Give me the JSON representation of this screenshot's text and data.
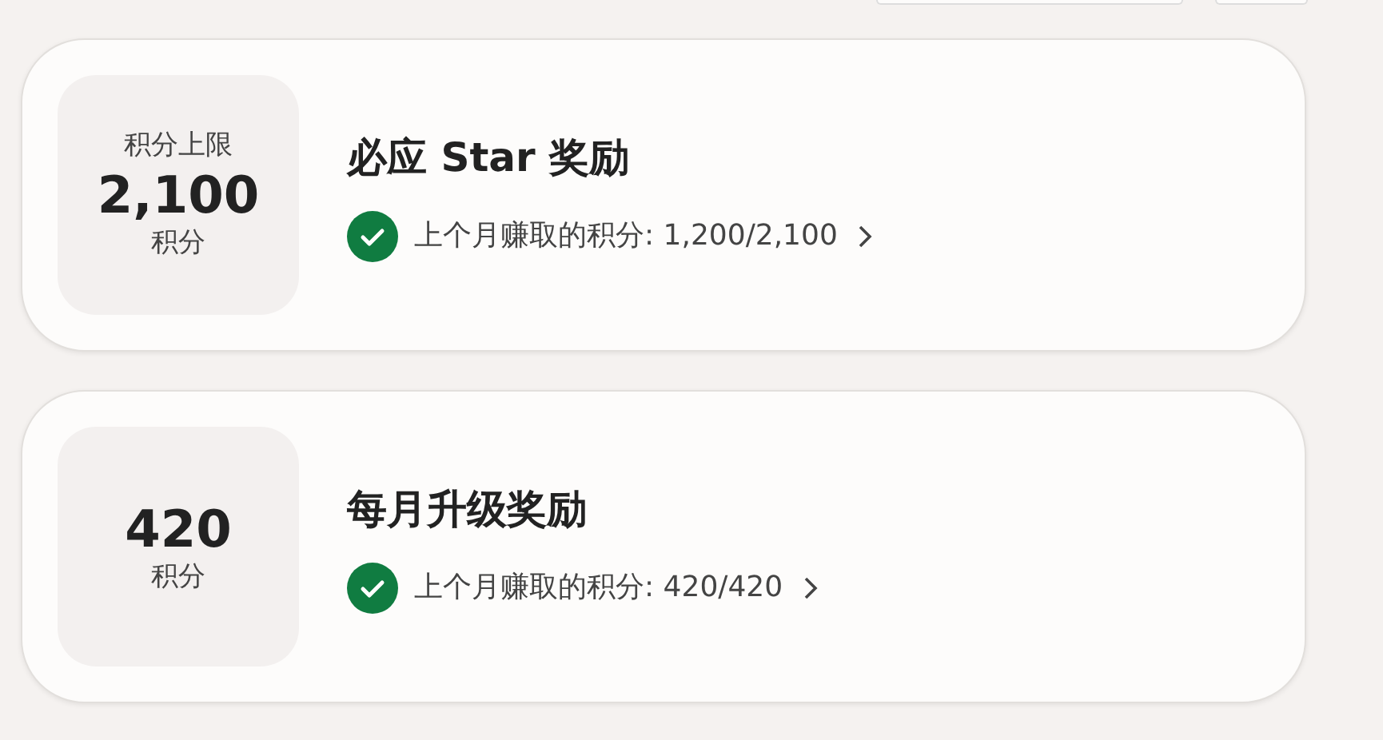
{
  "rewards": [
    {
      "cap_label": "积分上限",
      "points": "2,100",
      "unit": "积分",
      "title": "必应 Star 奖励",
      "progress": "上个月赚取的积分: 1,200/2,100",
      "completed": true
    },
    {
      "points": "420",
      "unit": "积分",
      "title": "每月升级奖励",
      "progress": "上个月赚取的积分: 420/420",
      "completed": true
    }
  ]
}
